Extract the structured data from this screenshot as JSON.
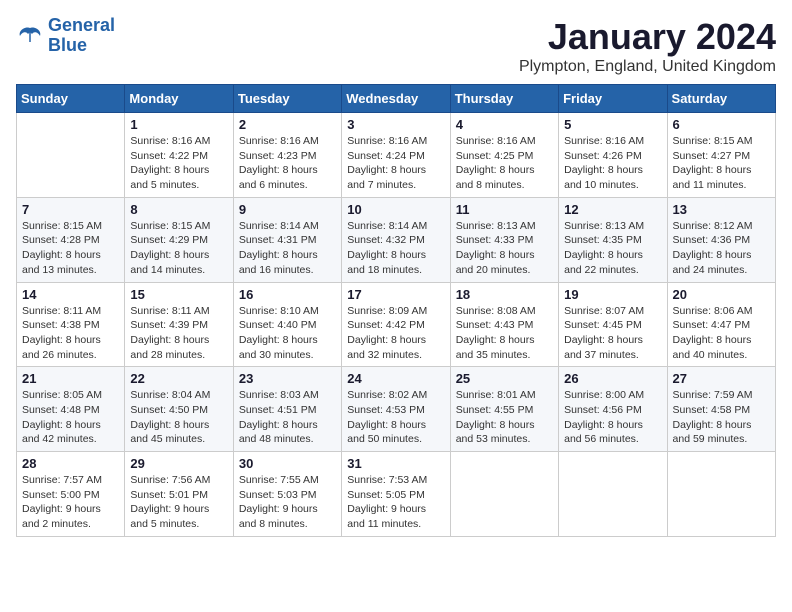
{
  "header": {
    "logo_line1": "General",
    "logo_line2": "Blue",
    "month": "January 2024",
    "location": "Plympton, England, United Kingdom"
  },
  "weekdays": [
    "Sunday",
    "Monday",
    "Tuesday",
    "Wednesday",
    "Thursday",
    "Friday",
    "Saturday"
  ],
  "weeks": [
    [
      {
        "day": "",
        "sunrise": "",
        "sunset": "",
        "daylight": ""
      },
      {
        "day": "1",
        "sunrise": "Sunrise: 8:16 AM",
        "sunset": "Sunset: 4:22 PM",
        "daylight": "Daylight: 8 hours and 5 minutes."
      },
      {
        "day": "2",
        "sunrise": "Sunrise: 8:16 AM",
        "sunset": "Sunset: 4:23 PM",
        "daylight": "Daylight: 8 hours and 6 minutes."
      },
      {
        "day": "3",
        "sunrise": "Sunrise: 8:16 AM",
        "sunset": "Sunset: 4:24 PM",
        "daylight": "Daylight: 8 hours and 7 minutes."
      },
      {
        "day": "4",
        "sunrise": "Sunrise: 8:16 AM",
        "sunset": "Sunset: 4:25 PM",
        "daylight": "Daylight: 8 hours and 8 minutes."
      },
      {
        "day": "5",
        "sunrise": "Sunrise: 8:16 AM",
        "sunset": "Sunset: 4:26 PM",
        "daylight": "Daylight: 8 hours and 10 minutes."
      },
      {
        "day": "6",
        "sunrise": "Sunrise: 8:15 AM",
        "sunset": "Sunset: 4:27 PM",
        "daylight": "Daylight: 8 hours and 11 minutes."
      }
    ],
    [
      {
        "day": "7",
        "sunrise": "Sunrise: 8:15 AM",
        "sunset": "Sunset: 4:28 PM",
        "daylight": "Daylight: 8 hours and 13 minutes."
      },
      {
        "day": "8",
        "sunrise": "Sunrise: 8:15 AM",
        "sunset": "Sunset: 4:29 PM",
        "daylight": "Daylight: 8 hours and 14 minutes."
      },
      {
        "day": "9",
        "sunrise": "Sunrise: 8:14 AM",
        "sunset": "Sunset: 4:31 PM",
        "daylight": "Daylight: 8 hours and 16 minutes."
      },
      {
        "day": "10",
        "sunrise": "Sunrise: 8:14 AM",
        "sunset": "Sunset: 4:32 PM",
        "daylight": "Daylight: 8 hours and 18 minutes."
      },
      {
        "day": "11",
        "sunrise": "Sunrise: 8:13 AM",
        "sunset": "Sunset: 4:33 PM",
        "daylight": "Daylight: 8 hours and 20 minutes."
      },
      {
        "day": "12",
        "sunrise": "Sunrise: 8:13 AM",
        "sunset": "Sunset: 4:35 PM",
        "daylight": "Daylight: 8 hours and 22 minutes."
      },
      {
        "day": "13",
        "sunrise": "Sunrise: 8:12 AM",
        "sunset": "Sunset: 4:36 PM",
        "daylight": "Daylight: 8 hours and 24 minutes."
      }
    ],
    [
      {
        "day": "14",
        "sunrise": "Sunrise: 8:11 AM",
        "sunset": "Sunset: 4:38 PM",
        "daylight": "Daylight: 8 hours and 26 minutes."
      },
      {
        "day": "15",
        "sunrise": "Sunrise: 8:11 AM",
        "sunset": "Sunset: 4:39 PM",
        "daylight": "Daylight: 8 hours and 28 minutes."
      },
      {
        "day": "16",
        "sunrise": "Sunrise: 8:10 AM",
        "sunset": "Sunset: 4:40 PM",
        "daylight": "Daylight: 8 hours and 30 minutes."
      },
      {
        "day": "17",
        "sunrise": "Sunrise: 8:09 AM",
        "sunset": "Sunset: 4:42 PM",
        "daylight": "Daylight: 8 hours and 32 minutes."
      },
      {
        "day": "18",
        "sunrise": "Sunrise: 8:08 AM",
        "sunset": "Sunset: 4:43 PM",
        "daylight": "Daylight: 8 hours and 35 minutes."
      },
      {
        "day": "19",
        "sunrise": "Sunrise: 8:07 AM",
        "sunset": "Sunset: 4:45 PM",
        "daylight": "Daylight: 8 hours and 37 minutes."
      },
      {
        "day": "20",
        "sunrise": "Sunrise: 8:06 AM",
        "sunset": "Sunset: 4:47 PM",
        "daylight": "Daylight: 8 hours and 40 minutes."
      }
    ],
    [
      {
        "day": "21",
        "sunrise": "Sunrise: 8:05 AM",
        "sunset": "Sunset: 4:48 PM",
        "daylight": "Daylight: 8 hours and 42 minutes."
      },
      {
        "day": "22",
        "sunrise": "Sunrise: 8:04 AM",
        "sunset": "Sunset: 4:50 PM",
        "daylight": "Daylight: 8 hours and 45 minutes."
      },
      {
        "day": "23",
        "sunrise": "Sunrise: 8:03 AM",
        "sunset": "Sunset: 4:51 PM",
        "daylight": "Daylight: 8 hours and 48 minutes."
      },
      {
        "day": "24",
        "sunrise": "Sunrise: 8:02 AM",
        "sunset": "Sunset: 4:53 PM",
        "daylight": "Daylight: 8 hours and 50 minutes."
      },
      {
        "day": "25",
        "sunrise": "Sunrise: 8:01 AM",
        "sunset": "Sunset: 4:55 PM",
        "daylight": "Daylight: 8 hours and 53 minutes."
      },
      {
        "day": "26",
        "sunrise": "Sunrise: 8:00 AM",
        "sunset": "Sunset: 4:56 PM",
        "daylight": "Daylight: 8 hours and 56 minutes."
      },
      {
        "day": "27",
        "sunrise": "Sunrise: 7:59 AM",
        "sunset": "Sunset: 4:58 PM",
        "daylight": "Daylight: 8 hours and 59 minutes."
      }
    ],
    [
      {
        "day": "28",
        "sunrise": "Sunrise: 7:57 AM",
        "sunset": "Sunset: 5:00 PM",
        "daylight": "Daylight: 9 hours and 2 minutes."
      },
      {
        "day": "29",
        "sunrise": "Sunrise: 7:56 AM",
        "sunset": "Sunset: 5:01 PM",
        "daylight": "Daylight: 9 hours and 5 minutes."
      },
      {
        "day": "30",
        "sunrise": "Sunrise: 7:55 AM",
        "sunset": "Sunset: 5:03 PM",
        "daylight": "Daylight: 9 hours and 8 minutes."
      },
      {
        "day": "31",
        "sunrise": "Sunrise: 7:53 AM",
        "sunset": "Sunset: 5:05 PM",
        "daylight": "Daylight: 9 hours and 11 minutes."
      },
      {
        "day": "",
        "sunrise": "",
        "sunset": "",
        "daylight": ""
      },
      {
        "day": "",
        "sunrise": "",
        "sunset": "",
        "daylight": ""
      },
      {
        "day": "",
        "sunrise": "",
        "sunset": "",
        "daylight": ""
      }
    ]
  ]
}
